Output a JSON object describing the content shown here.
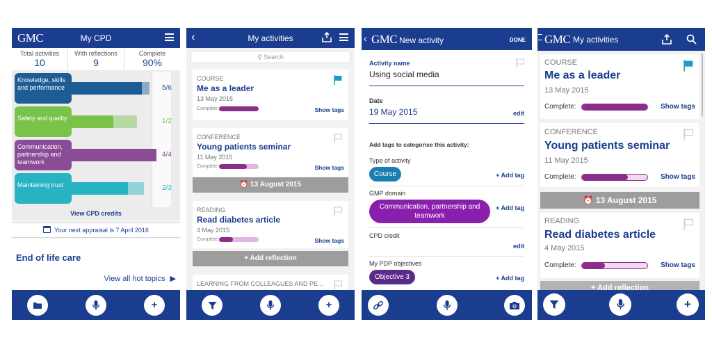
{
  "colors": {
    "brand_blue": "#1a3d8f",
    "knowledge": "#1e5c95",
    "safety": "#79c34a",
    "communication": "#8a4b97",
    "trust": "#27b3c2",
    "complete_purple": "#8b2d8b",
    "flag_teal": "#1a9dc9"
  },
  "screen1": {
    "brand": "GMC",
    "title": "My CPD",
    "stats": [
      {
        "label": "Total activities",
        "value": "10"
      },
      {
        "label": "With reflections",
        "value": "9"
      },
      {
        "label": "Complete",
        "value": "90%"
      }
    ],
    "categories": [
      {
        "label": "Knowledge, skills and performance",
        "score": "5/6",
        "fraction": 0.8333
      },
      {
        "label": "Safety and quality",
        "score": "1/2",
        "fraction": 0.5
      },
      {
        "label": "Communication, partnership and teamwork",
        "score": "4/4",
        "fraction": 1.0
      },
      {
        "label": "Maintaining trust",
        "score": "2/3",
        "fraction": 0.6667
      }
    ],
    "view_credits": "View CPD credits",
    "appraisal": "Your next appraisal is 7 April 2016",
    "hot_topic": "End of life care",
    "hot_link": "View all hot topics",
    "icons": {
      "menu": "hamburger-menu-icon",
      "calendar": "calendar-icon",
      "folder": "folder-icon",
      "mic": "microphone-icon",
      "add": "plus-icon"
    }
  },
  "screen2": {
    "title": "My activities",
    "search_placeholder": "Search",
    "activities": [
      {
        "type": "COURSE",
        "title": "Me as a leader",
        "date": "13 May 2015",
        "complete_label": "Complete:",
        "progress": 1.0,
        "flagged": true,
        "show_tags": "Show tags"
      },
      {
        "type": "CONFERENCE",
        "title": "Young patients seminar",
        "date": "11 May 2015",
        "complete_label": "Complete:",
        "progress": 0.7,
        "flagged": false,
        "show_tags": "Show tags"
      },
      {
        "type": "READING",
        "title": "Read diabetes article",
        "date": "4 May 2015",
        "complete_label": "Complete:",
        "progress": 0.35,
        "flagged": false,
        "show_tags": "Show tags"
      }
    ],
    "date_divider": "13 August 2015",
    "add_reflection": "Add reflection",
    "truncated_item": "LEARNING FROM COLLEAGUES AND PE..."
  },
  "screen3": {
    "brand": "GMC",
    "title": "New activity",
    "done": "DONE",
    "activity_name_label": "Activity name",
    "activity_name": "Using social media",
    "date_label": "Date",
    "date": "19 May 2015",
    "edit": "edit",
    "tags_intro": "Add tags to categorise this activity:",
    "type_label": "Type of activity",
    "type_tag": "Course",
    "gmp_label": "GMP domain",
    "gmp_tag": "Communication, partnership and teamwork",
    "cpd_label": "CPD credit",
    "pdp_label": "My PDP objectives",
    "pdp_tag": "Objective 3",
    "add_tag": "+ Add tag"
  },
  "screen4": {
    "brand": "GMC",
    "title": "My activities",
    "activities": [
      {
        "type": "COURSE",
        "title": "Me as a leader",
        "date": "13 May 2015",
        "complete_label": "Complete:",
        "progress": 1.0,
        "flagged": true,
        "show_tags": "Show tags"
      },
      {
        "type": "CONFERENCE",
        "title": "Young patients seminar",
        "date": "11 May 2015",
        "complete_label": "Complete:",
        "progress": 0.7,
        "flagged": false,
        "show_tags": "Show tags"
      },
      {
        "type": "READING",
        "title": "Read diabetes article",
        "date": "4 May 2015",
        "complete_label": "Complete:",
        "progress": 0.35,
        "flagged": false,
        "show_tags": "Show tags"
      }
    ],
    "date_divider": "13 August 2015",
    "add_reflection": "Add reflection"
  }
}
